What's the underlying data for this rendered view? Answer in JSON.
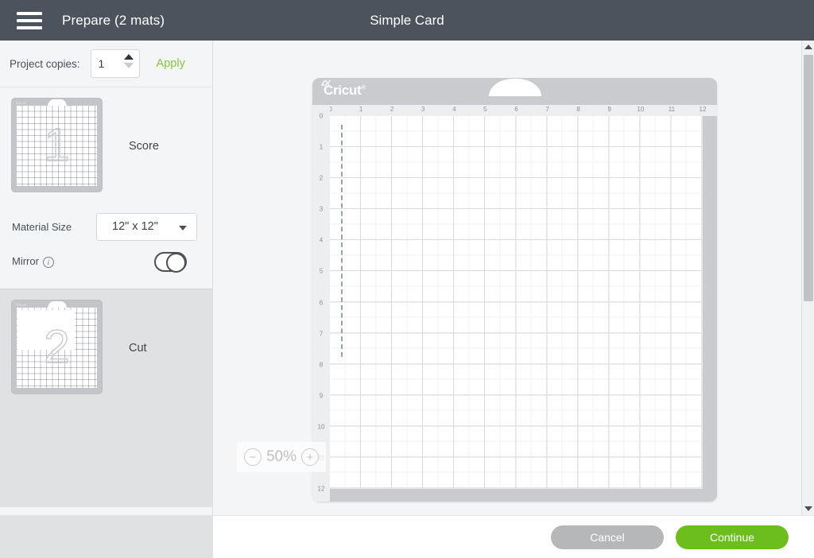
{
  "topbar": {
    "menu_icon": "hamburger-icon",
    "left_title": "Prepare (2 mats)",
    "center_title": "Simple Card"
  },
  "sidebar": {
    "copies": {
      "label": "Project copies:",
      "value": "1",
      "apply_label": "Apply"
    },
    "mats": [
      {
        "number": "1",
        "caption": "Score",
        "state": "active",
        "brand": "Cricut",
        "options": {
          "material_size_label": "Material Size",
          "material_size_value": "12\" x 12\"",
          "mirror_label": "Mirror",
          "mirror_info_icon": "info-icon",
          "mirror_value": "off"
        }
      },
      {
        "number": "2",
        "caption": "Cut",
        "state": "inactive",
        "brand": "Cricut"
      }
    ]
  },
  "canvas": {
    "brand": "Cricut",
    "brand_tm": "®",
    "ruler_top_ticks": [
      "0",
      "1",
      "2",
      "3",
      "4",
      "5",
      "6",
      "7",
      "8",
      "9",
      "10",
      "11",
      "12"
    ],
    "ruler_left_ticks": [
      "0",
      "1",
      "2",
      "3",
      "4",
      "5",
      "6",
      "7",
      "8",
      "9",
      "10",
      "11",
      "12"
    ],
    "zoom": {
      "minus_label": "−",
      "value": "50%",
      "plus_label": "+"
    }
  },
  "scrollbar": {
    "up_icon": "scroll-up-arrow-icon",
    "down_icon": "scroll-down-arrow-icon"
  },
  "footer": {
    "cancel_label": "Cancel",
    "continue_label": "Continue"
  },
  "colors": {
    "topbar_bg": "#4b545c",
    "accent_green": "#6cbe1f",
    "apply_green": "#8bbf3d",
    "cancel_gray": "#b5b7b9",
    "mat_gray": "#c9cbce",
    "panel_bg": "#f4f5f7",
    "panel_inactive_bg": "#e0e1e3"
  }
}
